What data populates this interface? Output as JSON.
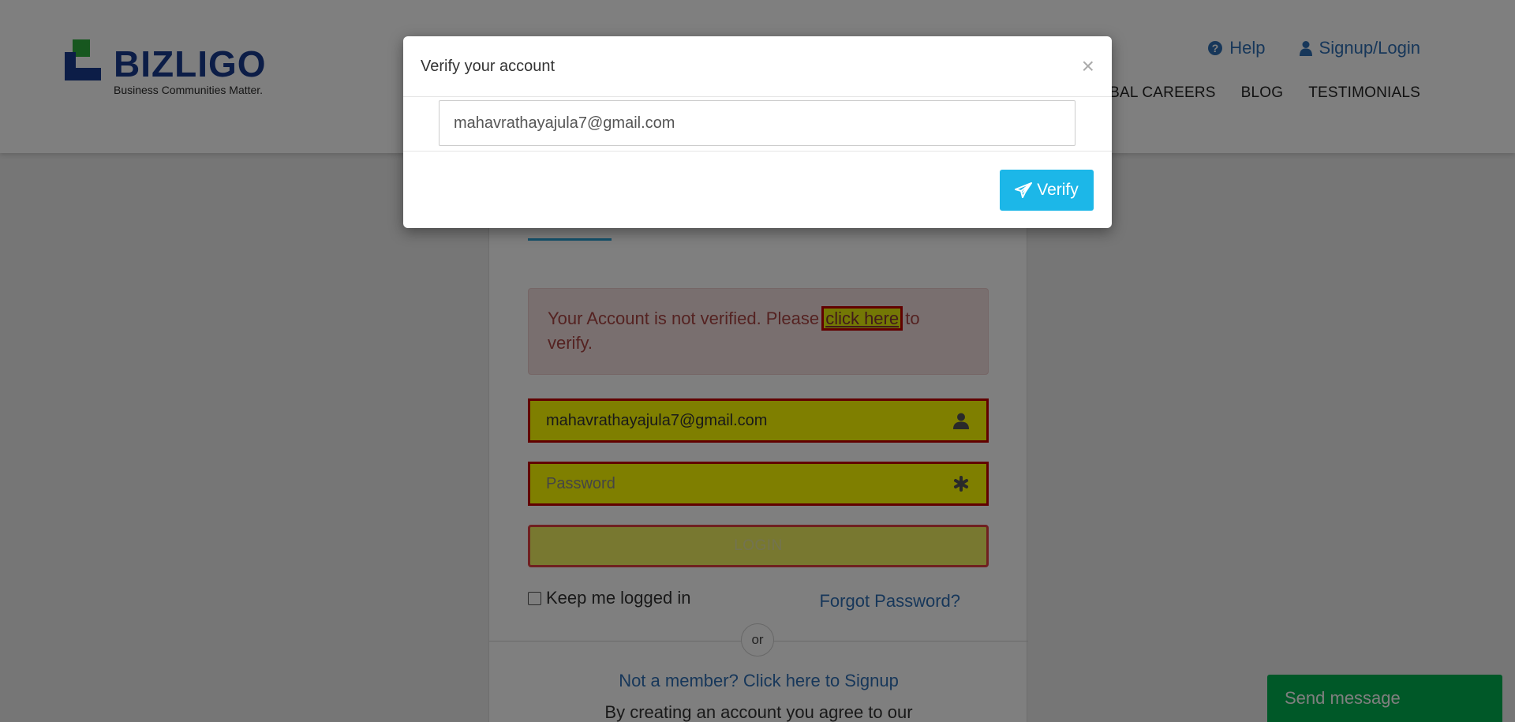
{
  "header": {
    "logo": {
      "wordmark": "BIZLIGO",
      "tagline": "Business Communities Matter."
    },
    "top_links": [
      {
        "label": "Help",
        "icon": "question-circle-icon"
      },
      {
        "label": "Signup/Login",
        "icon": "user-icon"
      }
    ],
    "nav": [
      "LOBAL CAREERS",
      "BLOG",
      "TESTIMONIALS"
    ]
  },
  "login": {
    "alert": {
      "text_before": "Your Account is not verified. Please ",
      "link": "click here",
      "text_after": " to verify."
    },
    "email_value": "mahavrathayajula7@gmail.com",
    "password_placeholder": "Password",
    "login_button": "LOGIN",
    "keep_logged_in": "Keep me logged in",
    "forgot_password": "Forgot Password?",
    "or": "or",
    "signup_link": "Not a member? Click here to Signup",
    "terms": "By creating an account you agree to our"
  },
  "modal": {
    "title": "Verify your account",
    "close": "×",
    "email_value": "mahavrathayajula7@gmail.com",
    "verify_button": "Verify"
  },
  "chat": {
    "send_message": "Send message"
  },
  "colors": {
    "brand_blue": "#183b8f",
    "link_blue": "#2f6fb4",
    "verify_button": "#1cb7e8",
    "send_message": "#00b050",
    "highlight_yellow": "#ffff00",
    "highlight_border": "#c20000",
    "alert_bg": "#f2dede",
    "alert_text": "#a94442"
  }
}
